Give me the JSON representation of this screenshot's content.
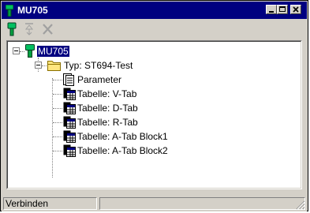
{
  "window": {
    "title": "MU705",
    "controls": [
      "minimize",
      "maximize",
      "close"
    ]
  },
  "toolbar": {
    "buttons": [
      {
        "icon": "device-connect-icon",
        "enabled": true
      },
      {
        "icon": "sort-icon",
        "enabled": false
      },
      {
        "icon": "delete-icon",
        "enabled": false
      }
    ]
  },
  "tree": {
    "root": {
      "label": "MU705",
      "selected": true,
      "expanded": true
    },
    "type_node": {
      "label": "Typ: ST694-Test",
      "expanded": true
    },
    "children": [
      {
        "label": "Parameter",
        "icon": "parameter-icon"
      },
      {
        "label": "Tabelle: V-Tab",
        "icon": "table-icon"
      },
      {
        "label": "Tabelle: D-Tab",
        "icon": "table-icon"
      },
      {
        "label": "Tabelle: R-Tab",
        "icon": "table-icon"
      },
      {
        "label": "Tabelle: A-Tab Block1",
        "icon": "table-icon"
      },
      {
        "label": "Tabelle: A-Tab Block2",
        "icon": "table-icon"
      }
    ]
  },
  "statusbar": {
    "text": "Verbinden",
    "text2": ""
  },
  "colors": {
    "titlebar": "#000080",
    "face": "#d4d0c8",
    "selection": "#000080",
    "device_green": "#00a040"
  }
}
